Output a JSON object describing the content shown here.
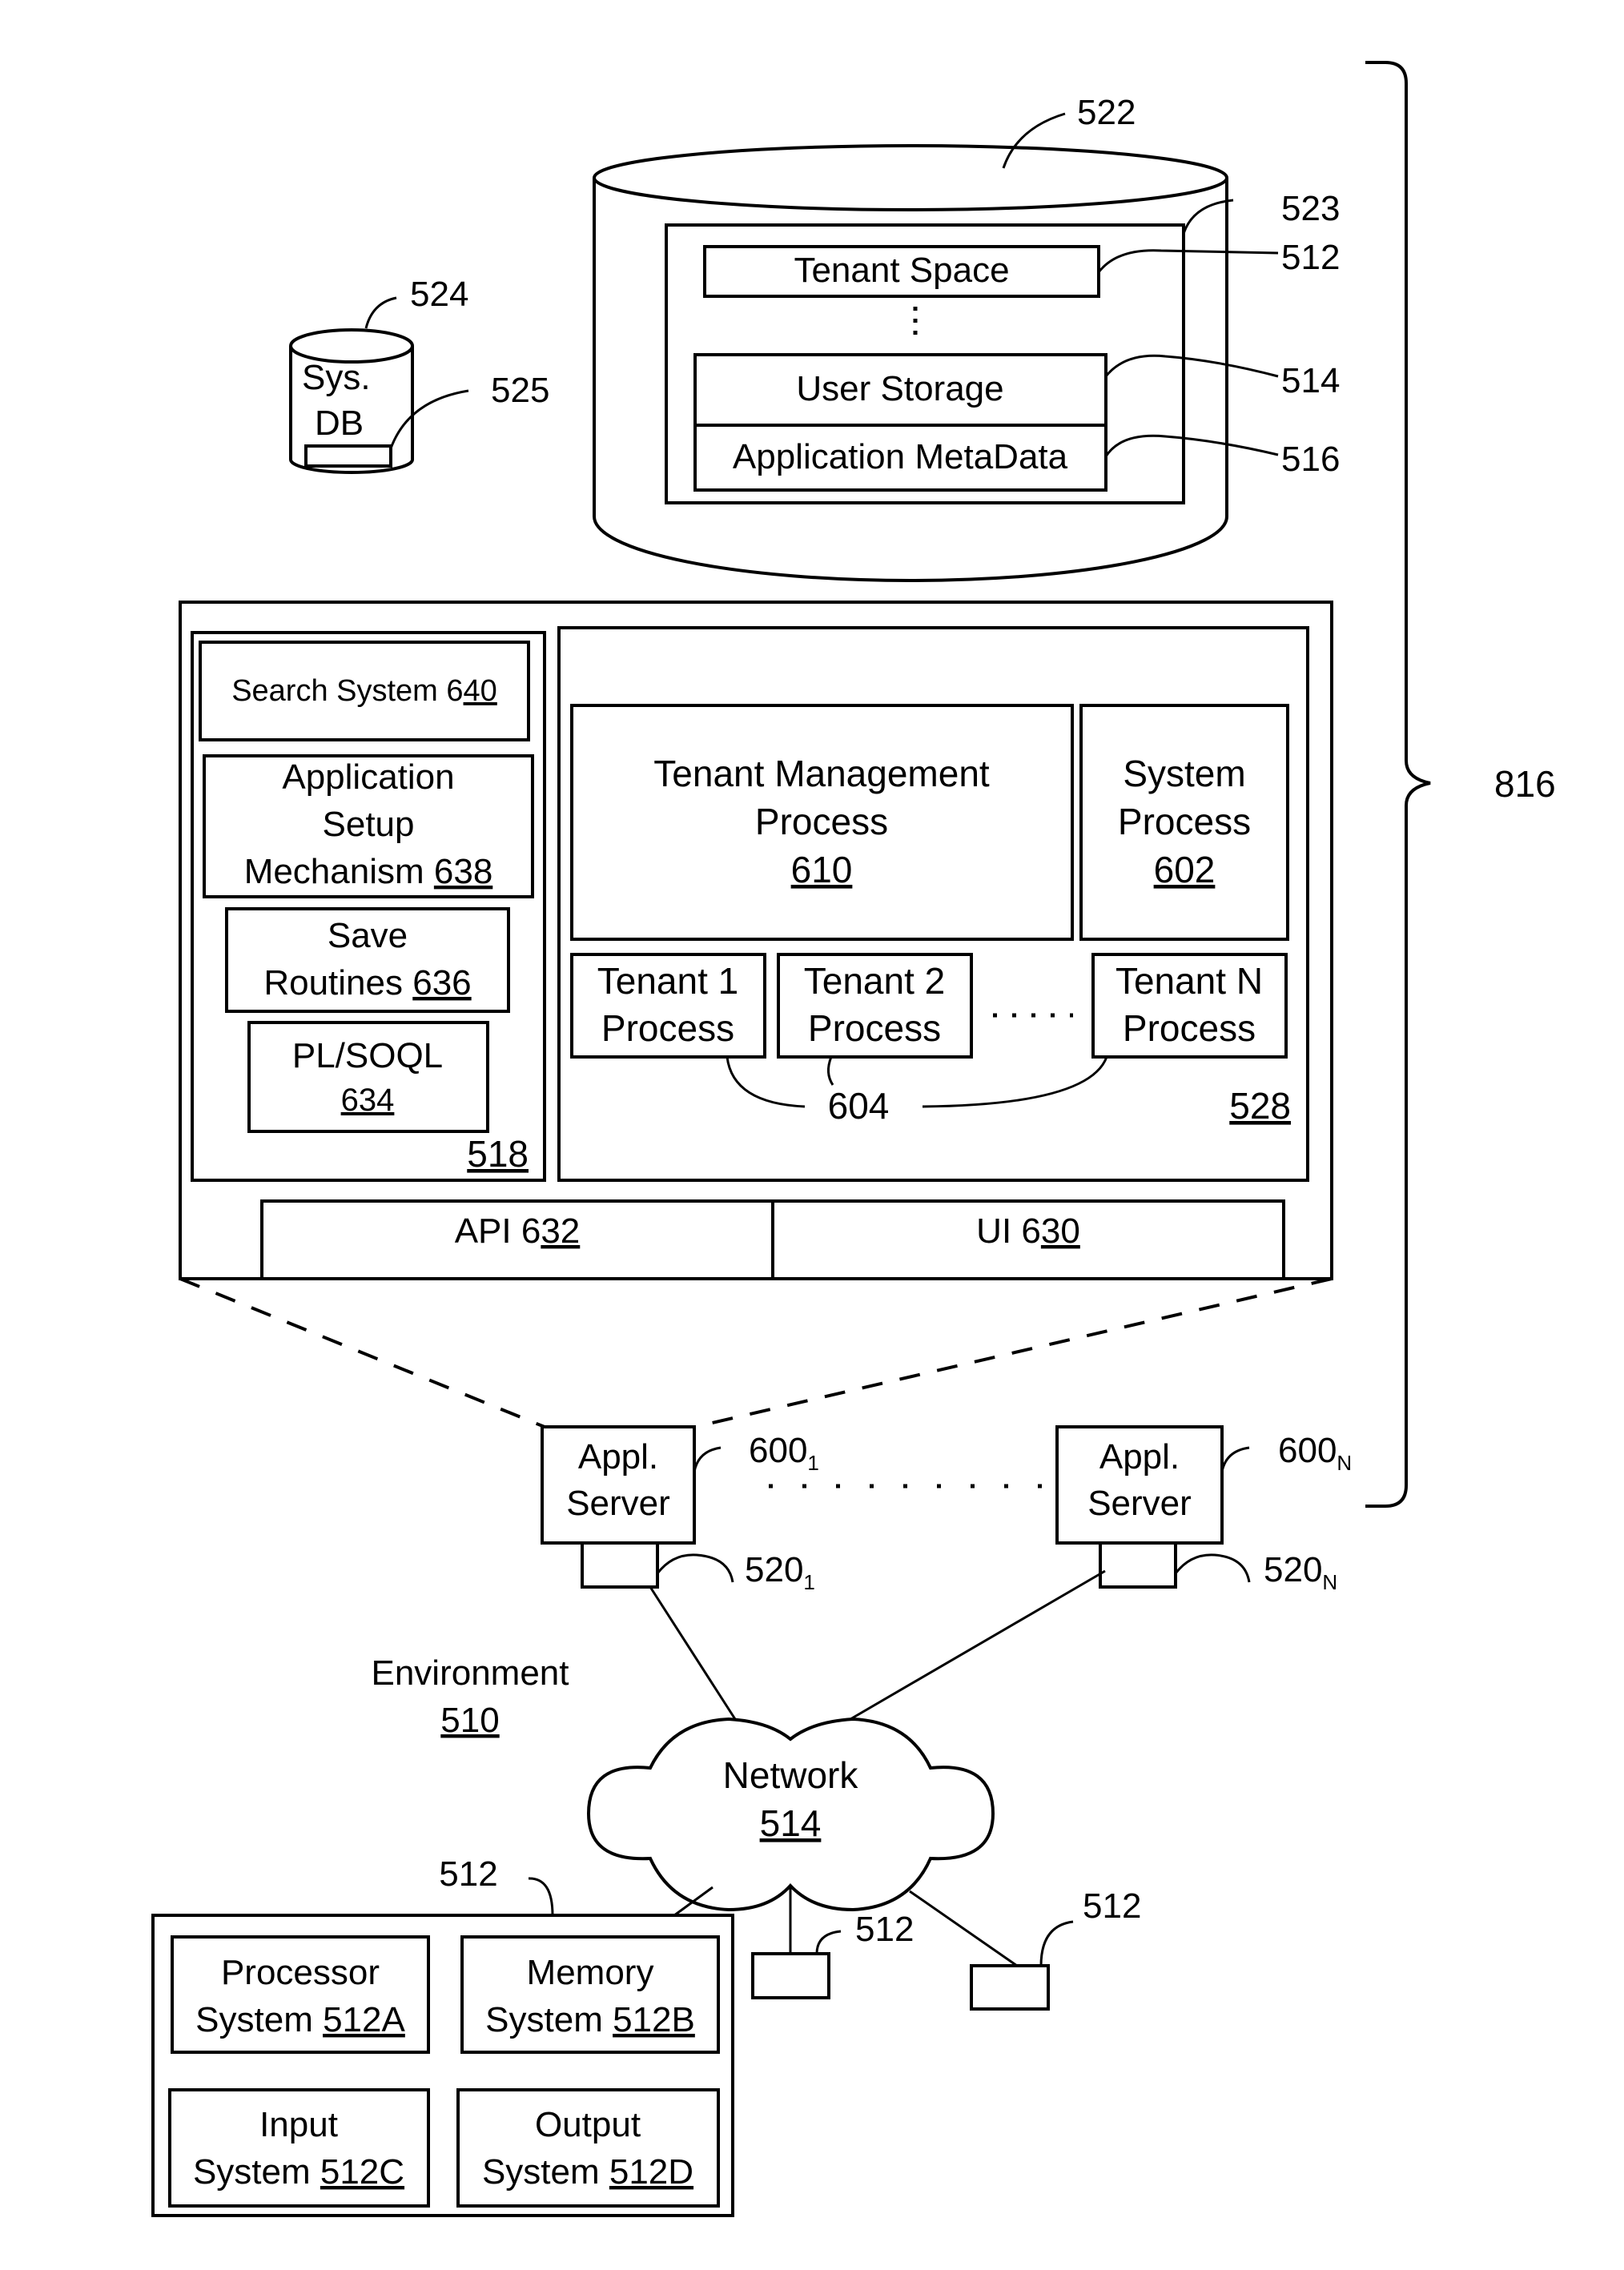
{
  "figure": {
    "brace_ref": "816",
    "environment": {
      "label": "Environment",
      "ref": "510"
    },
    "tenant_db": {
      "ref": "522",
      "inner_ref": "523",
      "tenant_space": {
        "label": "Tenant Space",
        "ref": "512"
      },
      "user_storage": {
        "label": "User Storage",
        "ref": "514"
      },
      "app_metadata": {
        "label": "Application MetaData",
        "ref": "516"
      }
    },
    "system_db": {
      "line1": "Sys.",
      "line2": "DB",
      "ref": "524",
      "inner_ref": "525"
    },
    "app_platform": {
      "ref": "518",
      "search_system": {
        "label": "Search System 6",
        "ref": "40"
      },
      "app_setup": {
        "line1": "Application",
        "line2": "Setup",
        "line3": "Mechanism ",
        "ref": "638"
      },
      "save_routines": {
        "line1": "Save",
        "line2": "Routines ",
        "ref": "636"
      },
      "plsoql": {
        "line1": "PL/SOQL",
        "ref": "634"
      }
    },
    "process_space": {
      "ref": "528",
      "tenant_mgmt": {
        "line1": "Tenant Management",
        "line2": "Process",
        "ref": "610"
      },
      "system_process": {
        "line1": "System",
        "line2": "Process",
        "ref": "602"
      },
      "tenant_processes": [
        {
          "line1": "Tenant 1",
          "line2": "Process"
        },
        {
          "line1": "Tenant 2",
          "line2": "Process"
        },
        {
          "line1": "Tenant N",
          "line2": "Process"
        }
      ],
      "tenant_process_ref": "604"
    },
    "api": {
      "label": "API 6",
      "ref": "32"
    },
    "ui": {
      "label": "UI 6",
      "ref": "30"
    },
    "app_servers": [
      {
        "line1": "Appl.",
        "line2": "Server",
        "ref": "600",
        "sub": "1",
        "port_ref": "520",
        "port_sub": "1"
      },
      {
        "line1": "Appl.",
        "line2": "Server",
        "ref": "600",
        "sub": "N",
        "port_ref": "520",
        "port_sub": "N"
      }
    ],
    "network": {
      "label": "Network",
      "ref": "514"
    },
    "user_system": {
      "ref": "512",
      "components": [
        {
          "line1": "Processor",
          "line2": "System ",
          "ref": "512A"
        },
        {
          "line1": "Memory",
          "line2": "System ",
          "ref": "512B"
        },
        {
          "line1": "Input",
          "line2": "System ",
          "ref": "512C"
        },
        {
          "line1": "Output",
          "line2": "System ",
          "ref": "512D"
        }
      ]
    },
    "client_refs": [
      "512",
      "512"
    ]
  }
}
